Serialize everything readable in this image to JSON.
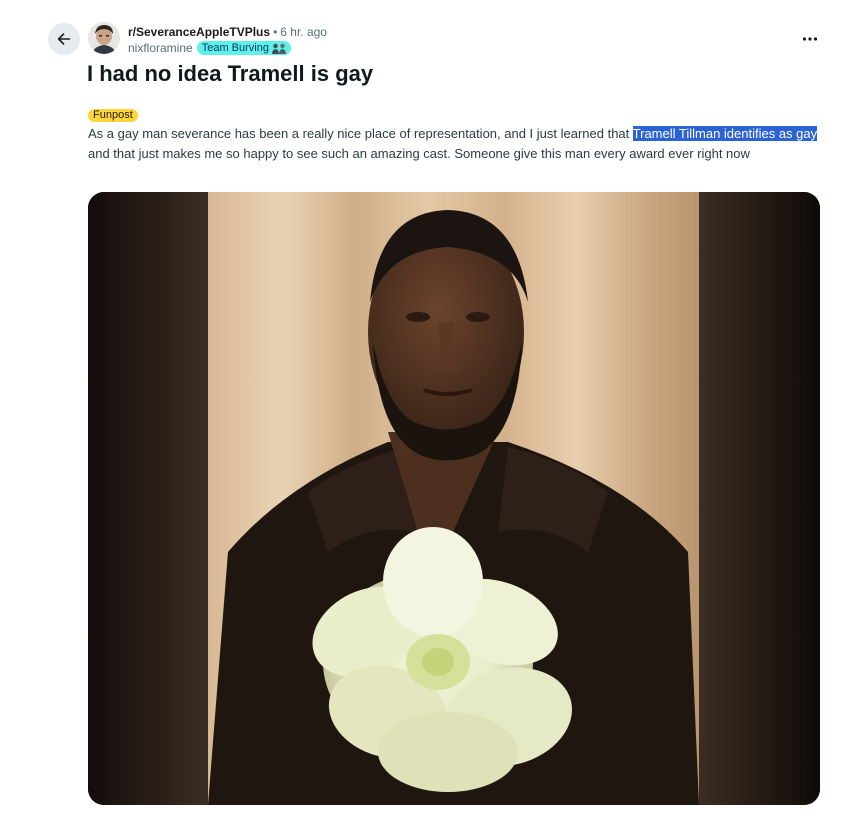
{
  "header": {
    "subreddit": "r/SeveranceAppleTVPlus",
    "separator": "•",
    "time_ago": "6 hr. ago",
    "username": "nixfloramine",
    "user_flair": "Team Burving"
  },
  "post": {
    "title": "I had no idea Tramell is gay",
    "flair": "Funpost",
    "body_before": "As a gay man severance has been a really nice place of representation, and I just learned that ",
    "body_highlight": "Tramell Tillman identifies as gay",
    "body_after": " and that just makes me so happy to see such an amazing cast. Someone give this man every award ever right now"
  },
  "icons": {
    "back": "arrow-left-icon",
    "overflow": "more-horizontal-icon"
  },
  "colors": {
    "user_flair_bg": "#5ef0ec",
    "post_flair_bg": "#ffd635",
    "selection_highlight": "#2b62d4",
    "back_button_bg": "#e5ebee"
  }
}
